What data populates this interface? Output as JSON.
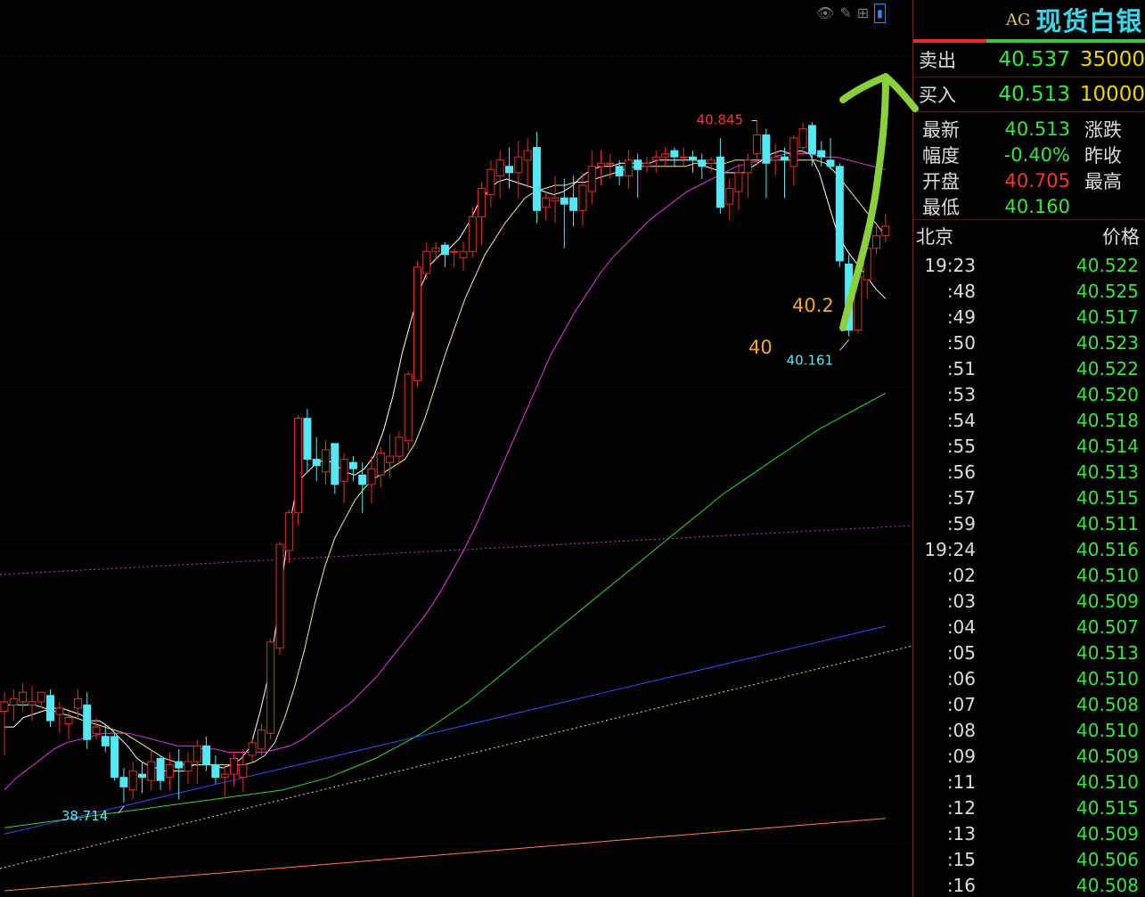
{
  "panel": {
    "code": "AG",
    "name": "现货白银",
    "sell_label": "卖出",
    "sell_price": "40.537",
    "sell_qty": "35000",
    "buy_label": "买入",
    "buy_price": "40.513",
    "buy_qty": "10000",
    "stats": [
      {
        "k": "最新",
        "v": "40.513",
        "color": "green",
        "k2": "涨跌"
      },
      {
        "k": "幅度",
        "v": "-0.40%",
        "color": "green",
        "k2": "昨收"
      },
      {
        "k": "开盘",
        "v": "40.705",
        "color": "red",
        "k2": "最高"
      },
      {
        "k": "最低",
        "v": "40.160",
        "color": "green",
        "k2": ""
      }
    ],
    "ticks_header_left": "北京",
    "ticks_header_right": "价格",
    "ticks": [
      {
        "t": "19:23",
        "p": "40.522"
      },
      {
        "t": ":48",
        "p": "40.525"
      },
      {
        "t": ":49",
        "p": "40.517"
      },
      {
        "t": ":50",
        "p": "40.523"
      },
      {
        "t": ":51",
        "p": "40.522"
      },
      {
        "t": ":53",
        "p": "40.520"
      },
      {
        "t": ":54",
        "p": "40.518"
      },
      {
        "t": ":55",
        "p": "40.514"
      },
      {
        "t": ":56",
        "p": "40.513"
      },
      {
        "t": ":57",
        "p": "40.515"
      },
      {
        "t": ":59",
        "p": "40.511"
      },
      {
        "t": "19:24",
        "p": "40.516"
      },
      {
        "t": ":02",
        "p": "40.510"
      },
      {
        "t": ":03",
        "p": "40.509"
      },
      {
        "t": ":04",
        "p": "40.507"
      },
      {
        "t": ":05",
        "p": "40.513"
      },
      {
        "t": ":06",
        "p": "40.510"
      },
      {
        "t": ":07",
        "p": "40.508"
      },
      {
        "t": ":08",
        "p": "40.510"
      },
      {
        "t": ":09",
        "p": "40.509"
      },
      {
        "t": ":11",
        "p": "40.510"
      },
      {
        "t": ":12",
        "p": "40.515"
      },
      {
        "t": ":13",
        "p": "40.509"
      },
      {
        "t": ":15",
        "p": "40.506"
      },
      {
        "t": ":16",
        "p": "40.508"
      }
    ]
  },
  "toolbar": {
    "icons": [
      "eye-icon",
      "pencil-icon",
      "grid-icon",
      "panel-toggle-icon"
    ]
  },
  "colors": {
    "up": "#e0302a",
    "down": "#54e8f5",
    "ma5": "#ffffff",
    "ma10": "#f2ef86",
    "ma20": "#e33ae5",
    "ma60": "#35d435",
    "ma120": "#3d4df5",
    "ma250": "#ff7f3a"
  },
  "chart_data": {
    "type": "candlestick",
    "ylim": [
      38.4,
      41.2
    ],
    "reference_lines": [
      40.5,
      40.0
    ],
    "candles": [
      {
        "o": 38.97,
        "h": 39.03,
        "l": 38.83,
        "c": 39.0
      },
      {
        "o": 38.99,
        "h": 39.04,
        "l": 38.94,
        "c": 39.01
      },
      {
        "o": 39.0,
        "h": 39.06,
        "l": 38.97,
        "c": 39.03
      },
      {
        "o": 38.99,
        "h": 39.05,
        "l": 38.94,
        "c": 39.0
      },
      {
        "o": 39.0,
        "h": 39.03,
        "l": 38.98,
        "c": 39.03
      },
      {
        "o": 39.02,
        "h": 39.04,
        "l": 38.92,
        "c": 38.94
      },
      {
        "o": 38.96,
        "h": 39.0,
        "l": 38.9,
        "c": 38.98
      },
      {
        "o": 38.93,
        "h": 38.97,
        "l": 38.88,
        "c": 38.95
      },
      {
        "o": 38.98,
        "h": 39.04,
        "l": 38.95,
        "c": 39.01
      },
      {
        "o": 38.99,
        "h": 39.03,
        "l": 38.85,
        "c": 38.88
      },
      {
        "o": 38.9,
        "h": 38.95,
        "l": 38.88,
        "c": 38.92
      },
      {
        "o": 38.89,
        "h": 38.93,
        "l": 38.84,
        "c": 38.86
      },
      {
        "o": 38.89,
        "h": 38.9,
        "l": 38.75,
        "c": 38.76
      },
      {
        "o": 38.76,
        "h": 38.79,
        "l": 38.68,
        "c": 38.73
      },
      {
        "o": 38.72,
        "h": 38.81,
        "l": 38.69,
        "c": 38.78
      },
      {
        "o": 38.77,
        "h": 38.81,
        "l": 38.71,
        "c": 38.76
      },
      {
        "o": 38.75,
        "h": 38.85,
        "l": 38.72,
        "c": 38.81
      },
      {
        "o": 38.82,
        "h": 38.83,
        "l": 38.72,
        "c": 38.75
      },
      {
        "o": 38.76,
        "h": 38.84,
        "l": 38.72,
        "c": 38.8
      },
      {
        "o": 38.81,
        "h": 38.85,
        "l": 38.69,
        "c": 38.79
      },
      {
        "o": 38.78,
        "h": 38.84,
        "l": 38.74,
        "c": 38.81
      },
      {
        "o": 38.81,
        "h": 38.88,
        "l": 38.74,
        "c": 38.86
      },
      {
        "o": 38.86,
        "h": 38.89,
        "l": 38.78,
        "c": 38.8
      },
      {
        "o": 38.8,
        "h": 38.83,
        "l": 38.74,
        "c": 38.76
      },
      {
        "o": 38.76,
        "h": 38.8,
        "l": 38.7,
        "c": 38.77
      },
      {
        "o": 38.77,
        "h": 38.84,
        "l": 38.73,
        "c": 38.82
      },
      {
        "o": 38.76,
        "h": 38.85,
        "l": 38.714,
        "c": 38.8
      },
      {
        "o": 38.83,
        "h": 38.89,
        "l": 38.81,
        "c": 38.87
      },
      {
        "o": 38.85,
        "h": 38.93,
        "l": 38.83,
        "c": 38.91
      },
      {
        "o": 38.9,
        "h": 39.2,
        "l": 38.88,
        "c": 39.19
      },
      {
        "o": 39.17,
        "h": 39.51,
        "l": 39.15,
        "c": 39.5
      },
      {
        "o": 39.48,
        "h": 39.61,
        "l": 39.44,
        "c": 39.6
      },
      {
        "o": 39.6,
        "h": 39.91,
        "l": 39.56,
        "c": 39.9
      },
      {
        "o": 39.9,
        "h": 39.93,
        "l": 39.73,
        "c": 39.77
      },
      {
        "o": 39.77,
        "h": 39.84,
        "l": 39.7,
        "c": 39.75
      },
      {
        "o": 39.73,
        "h": 39.83,
        "l": 39.69,
        "c": 39.8
      },
      {
        "o": 39.82,
        "h": 39.82,
        "l": 39.66,
        "c": 39.69
      },
      {
        "o": 39.7,
        "h": 39.79,
        "l": 39.63,
        "c": 39.77
      },
      {
        "o": 39.76,
        "h": 39.78,
        "l": 39.7,
        "c": 39.74
      },
      {
        "o": 39.72,
        "h": 39.76,
        "l": 39.6,
        "c": 39.69
      },
      {
        "o": 39.69,
        "h": 39.78,
        "l": 39.63,
        "c": 39.74
      },
      {
        "o": 39.72,
        "h": 39.81,
        "l": 39.68,
        "c": 39.79
      },
      {
        "o": 39.76,
        "h": 39.85,
        "l": 39.71,
        "c": 39.78
      },
      {
        "o": 39.78,
        "h": 39.86,
        "l": 39.75,
        "c": 39.84
      },
      {
        "o": 39.83,
        "h": 40.05,
        "l": 39.8,
        "c": 40.04
      },
      {
        "o": 40.02,
        "h": 40.4,
        "l": 40.0,
        "c": 40.38
      },
      {
        "o": 40.36,
        "h": 40.46,
        "l": 40.34,
        "c": 40.43
      },
      {
        "o": 40.43,
        "h": 40.46,
        "l": 40.4,
        "c": 40.44
      },
      {
        "o": 40.45,
        "h": 40.46,
        "l": 40.38,
        "c": 40.42
      },
      {
        "o": 40.43,
        "h": 40.44,
        "l": 40.38,
        "c": 40.43
      },
      {
        "o": 40.41,
        "h": 40.46,
        "l": 40.37,
        "c": 40.43
      },
      {
        "o": 40.43,
        "h": 40.57,
        "l": 40.41,
        "c": 40.54
      },
      {
        "o": 40.54,
        "h": 40.65,
        "l": 40.45,
        "c": 40.63
      },
      {
        "o": 40.61,
        "h": 40.72,
        "l": 40.57,
        "c": 40.69
      },
      {
        "o": 40.67,
        "h": 40.75,
        "l": 40.6,
        "c": 40.72
      },
      {
        "o": 40.7,
        "h": 40.76,
        "l": 40.63,
        "c": 40.68
      },
      {
        "o": 40.68,
        "h": 40.78,
        "l": 40.6,
        "c": 40.73
      },
      {
        "o": 40.72,
        "h": 40.79,
        "l": 40.63,
        "c": 40.75
      },
      {
        "o": 40.76,
        "h": 40.81,
        "l": 40.52,
        "c": 40.56
      },
      {
        "o": 40.57,
        "h": 40.62,
        "l": 40.53,
        "c": 40.6
      },
      {
        "o": 40.59,
        "h": 40.67,
        "l": 40.52,
        "c": 40.6
      },
      {
        "o": 40.6,
        "h": 40.66,
        "l": 40.44,
        "c": 40.58
      },
      {
        "o": 40.6,
        "h": 40.67,
        "l": 40.51,
        "c": 40.56
      },
      {
        "o": 40.56,
        "h": 40.68,
        "l": 40.51,
        "c": 40.64
      },
      {
        "o": 40.62,
        "h": 40.75,
        "l": 40.58,
        "c": 40.7
      },
      {
        "o": 40.7,
        "h": 40.75,
        "l": 40.64,
        "c": 40.71
      },
      {
        "o": 40.71,
        "h": 40.74,
        "l": 40.66,
        "c": 40.71
      },
      {
        "o": 40.7,
        "h": 40.72,
        "l": 40.64,
        "c": 40.67
      },
      {
        "o": 40.67,
        "h": 40.75,
        "l": 40.63,
        "c": 40.72
      },
      {
        "o": 40.72,
        "h": 40.74,
        "l": 40.6,
        "c": 40.69
      },
      {
        "o": 40.7,
        "h": 40.73,
        "l": 40.68,
        "c": 40.71
      },
      {
        "o": 40.72,
        "h": 40.75,
        "l": 40.68,
        "c": 40.73
      },
      {
        "o": 40.73,
        "h": 40.76,
        "l": 40.7,
        "c": 40.74
      },
      {
        "o": 40.75,
        "h": 40.76,
        "l": 40.7,
        "c": 40.73
      },
      {
        "o": 40.73,
        "h": 40.76,
        "l": 40.7,
        "c": 40.73
      },
      {
        "o": 40.73,
        "h": 40.75,
        "l": 40.68,
        "c": 40.72
      },
      {
        "o": 40.72,
        "h": 40.74,
        "l": 40.66,
        "c": 40.7
      },
      {
        "o": 40.71,
        "h": 40.73,
        "l": 40.68,
        "c": 40.72
      },
      {
        "o": 40.73,
        "h": 40.79,
        "l": 40.55,
        "c": 40.57
      },
      {
        "o": 40.58,
        "h": 40.66,
        "l": 40.53,
        "c": 40.63
      },
      {
        "o": 40.62,
        "h": 40.71,
        "l": 40.56,
        "c": 40.68
      },
      {
        "o": 40.68,
        "h": 40.74,
        "l": 40.6,
        "c": 40.72
      },
      {
        "o": 40.74,
        "h": 40.845,
        "l": 40.7,
        "c": 40.8
      },
      {
        "o": 40.8,
        "h": 40.82,
        "l": 40.6,
        "c": 40.71
      },
      {
        "o": 40.72,
        "h": 40.77,
        "l": 40.67,
        "c": 40.73
      },
      {
        "o": 40.73,
        "h": 40.76,
        "l": 40.6,
        "c": 40.72
      },
      {
        "o": 40.7,
        "h": 40.8,
        "l": 40.64,
        "c": 40.79
      },
      {
        "o": 40.76,
        "h": 40.84,
        "l": 40.74,
        "c": 40.82
      },
      {
        "o": 40.83,
        "h": 40.84,
        "l": 40.7,
        "c": 40.74
      },
      {
        "o": 40.75,
        "h": 40.78,
        "l": 40.7,
        "c": 40.73
      },
      {
        "o": 40.72,
        "h": 40.79,
        "l": 40.69,
        "c": 40.7
      },
      {
        "o": 40.7,
        "h": 40.71,
        "l": 40.38,
        "c": 40.4
      },
      {
        "o": 40.39,
        "h": 40.42,
        "l": 40.161,
        "c": 40.18
      },
      {
        "o": 40.18,
        "h": 40.37,
        "l": 40.17,
        "c": 40.35
      },
      {
        "o": 40.34,
        "h": 40.47,
        "l": 40.28,
        "c": 40.44
      },
      {
        "o": 40.44,
        "h": 40.51,
        "l": 40.42,
        "c": 40.48
      },
      {
        "o": 40.48,
        "h": 40.55,
        "l": 40.46,
        "c": 40.51
      }
    ],
    "moving_averages": [
      {
        "name": "MA5",
        "color": "#ffffff",
        "x0": 0,
        "values": [
          38.92,
          38.92,
          38.95,
          38.96,
          38.97,
          38.98,
          38.98,
          38.97,
          38.96,
          38.94,
          38.94,
          38.92,
          38.89,
          38.86,
          38.82,
          38.8,
          38.79,
          38.78,
          38.78,
          38.78,
          38.8,
          38.8,
          38.8,
          38.79,
          38.8,
          38.82,
          38.86,
          38.97,
          39.1,
          39.31,
          39.55,
          39.7,
          39.73,
          39.76,
          39.77,
          39.75,
          39.73,
          39.72,
          39.74,
          39.78,
          39.86,
          39.97,
          40.11,
          40.22,
          40.32,
          40.39,
          40.42,
          40.44,
          40.47,
          40.52,
          40.58,
          40.62,
          40.65,
          40.66,
          40.65,
          40.64,
          40.63,
          40.62,
          40.61,
          40.62,
          40.64,
          40.67,
          40.69,
          40.7,
          40.7,
          40.71,
          40.71,
          40.71,
          40.71,
          40.72,
          40.72,
          40.72,
          40.72,
          40.72,
          40.7,
          40.69,
          40.68,
          40.68,
          40.68,
          40.7,
          40.72,
          40.74,
          40.75,
          40.74,
          40.75,
          40.74,
          40.68,
          40.58,
          40.48,
          40.43,
          40.39,
          40.35,
          40.31,
          40.28
        ]
      },
      {
        "name": "MA10",
        "color": "#f2ef86",
        "x0": 0,
        "values": [
          38.99,
          38.99,
          38.99,
          38.99,
          38.98,
          38.97,
          38.96,
          38.95,
          38.94,
          38.93,
          38.92,
          38.91,
          38.9,
          38.88,
          38.86,
          38.84,
          38.82,
          38.81,
          38.8,
          38.8,
          38.8,
          38.8,
          38.8,
          38.8,
          38.8,
          38.81,
          38.83,
          38.87,
          38.95,
          39.05,
          39.17,
          39.31,
          39.43,
          39.52,
          39.58,
          39.64,
          39.68,
          39.71,
          39.73,
          39.75,
          39.77,
          39.82,
          39.9,
          40.0,
          40.1,
          40.19,
          40.28,
          40.35,
          40.42,
          40.47,
          40.52,
          40.56,
          40.6,
          40.62,
          40.63,
          40.64,
          40.64,
          40.65,
          40.65,
          40.66,
          40.67,
          40.68,
          40.69,
          40.7,
          40.7,
          40.7,
          40.7,
          40.7,
          40.7,
          40.71,
          40.71,
          40.71,
          40.71,
          40.72,
          40.72,
          40.72,
          40.72,
          40.72,
          40.72,
          40.72,
          40.72,
          40.72,
          40.71,
          40.68,
          40.64,
          40.6,
          40.56,
          40.52,
          40.48
        ]
      },
      {
        "name": "MA20",
        "color": "#e33ae5",
        "x0": 0,
        "values": [
          38.72,
          38.76,
          38.79,
          38.82,
          38.85,
          38.87,
          38.88,
          38.89,
          38.9,
          38.9,
          38.9,
          38.89,
          38.88,
          38.87,
          38.86,
          38.86,
          38.85,
          38.85,
          38.84,
          38.84,
          38.84,
          38.84,
          38.85,
          38.86,
          38.88,
          38.91,
          38.94,
          38.97,
          39.0,
          39.04,
          39.08,
          39.13,
          39.18,
          39.23,
          39.28,
          39.34,
          39.41,
          39.48,
          39.56,
          39.65,
          39.74,
          39.83,
          39.92,
          40.01,
          40.1,
          40.17,
          40.24,
          40.3,
          40.36,
          40.41,
          40.45,
          40.49,
          40.53,
          40.56,
          40.59,
          40.62,
          40.64,
          40.66,
          40.68,
          40.7,
          40.71,
          40.72,
          40.73,
          40.74,
          40.74,
          40.74,
          40.73,
          40.73,
          40.72,
          40.71,
          40.7,
          40.69
        ]
      },
      {
        "name": "MA60",
        "color": "#35d435",
        "x0": 0,
        "values": [
          38.6,
          38.61,
          38.62,
          38.63,
          38.64,
          38.65,
          38.66,
          38.67,
          38.68,
          38.69,
          38.7,
          38.71,
          38.72,
          38.74,
          38.76,
          38.79,
          38.82,
          38.86,
          38.9,
          38.95,
          39.0,
          39.06,
          39.12,
          39.18,
          39.24,
          39.3,
          39.36,
          39.42,
          39.48,
          39.54,
          39.6,
          39.66,
          39.71,
          39.76,
          39.81,
          39.86,
          39.9,
          39.94,
          39.98
        ]
      },
      {
        "name": "MA120",
        "color": "#3d4df5",
        "x0": 0,
        "values": [
          38.58,
          38.6,
          38.62,
          38.64,
          38.66,
          38.68,
          38.7,
          38.72,
          38.74,
          38.76,
          38.78,
          38.8,
          38.82,
          38.84,
          38.86,
          38.88,
          38.9,
          38.92,
          38.94,
          38.96,
          38.98,
          39.0,
          39.02,
          39.04,
          39.06,
          39.08,
          39.1,
          39.12,
          39.14,
          39.16,
          39.18,
          39.2,
          39.22,
          39.24
        ]
      },
      {
        "name": "MA250",
        "color": "#ff7f3a",
        "x0": 0,
        "values": [
          38.4,
          38.41,
          38.42,
          38.43,
          38.44,
          38.45,
          38.46,
          38.47,
          38.48,
          38.49,
          38.5,
          38.51,
          38.52,
          38.53,
          38.54,
          38.55,
          38.56,
          38.57,
          38.58,
          38.59,
          38.6,
          38.61,
          38.62,
          38.63
        ]
      }
    ],
    "annotations": {
      "high_label": "40.845",
      "low_label": "40.161",
      "prior_low_label": "38.714",
      "level_label_1": "40.2",
      "level_label_2": "40"
    }
  }
}
